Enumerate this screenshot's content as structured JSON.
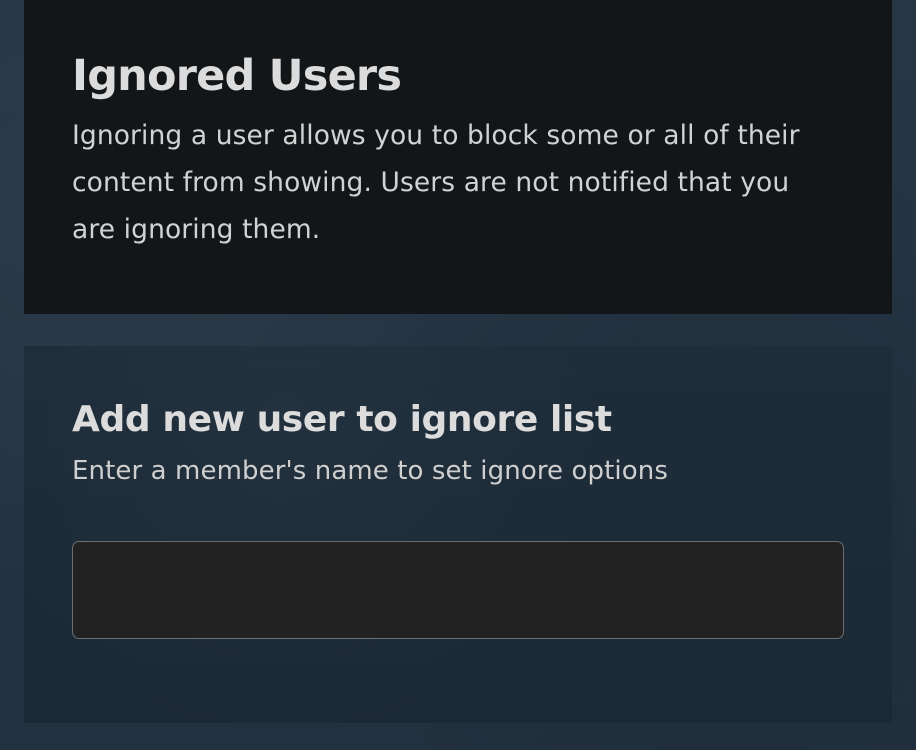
{
  "ignored_users": {
    "title": "Ignored Users",
    "description": "Ignoring a user allows you to block some or all of their content from showing. Users are not notified that you are ignoring them."
  },
  "add_user": {
    "title": "Add new user to ignore list",
    "subtitle": "Enter a member's name to set ignore options",
    "input": {
      "value": "",
      "placeholder": ""
    }
  }
}
